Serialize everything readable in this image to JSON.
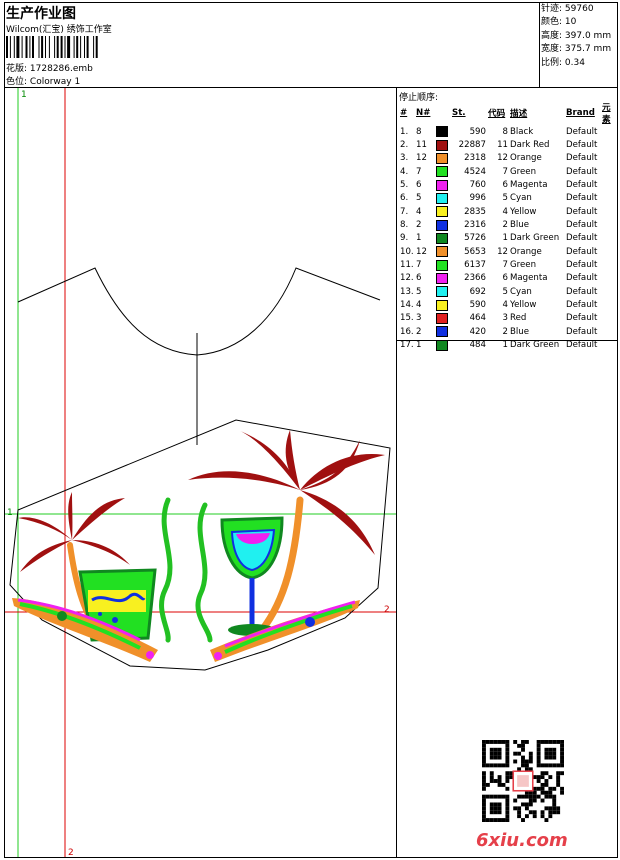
{
  "header": {
    "title": "生产作业图",
    "subtitle": "Wilcom(汇宝) 绣饰工作室",
    "design_label": "花版:",
    "design_value": "1728286.emb",
    "colorway_label": "色位:",
    "colorway_value": "Colorway 1"
  },
  "stats": [
    {
      "label": "针迹:",
      "value": "59760"
    },
    {
      "label": "颜色:",
      "value": "10"
    },
    {
      "label": "高度:",
      "value": "397.0 mm"
    },
    {
      "label": "宽度:",
      "value": "375.7 mm"
    },
    {
      "label": "比例:",
      "value": "0.34"
    }
  ],
  "stop_sequence_label": "停止顺序:",
  "table": {
    "headers": [
      "#",
      "N#",
      "St.",
      "代码",
      "描述",
      "Brand",
      "元素"
    ],
    "rows": [
      {
        "idx": "1.",
        "n": "8",
        "color": "#000000",
        "st": "590",
        "code": "8",
        "desc": "Black",
        "brand": "Default"
      },
      {
        "idx": "2.",
        "n": "11",
        "color": "#a01010",
        "st": "22887",
        "code": "11",
        "desc": "Dark Red",
        "brand": "Default"
      },
      {
        "idx": "3.",
        "n": "12",
        "color": "#f0902a",
        "st": "2318",
        "code": "12",
        "desc": "Orange",
        "brand": "Default"
      },
      {
        "idx": "4.",
        "n": "7",
        "color": "#22e022",
        "st": "4524",
        "code": "7",
        "desc": "Green",
        "brand": "Default"
      },
      {
        "idx": "5.",
        "n": "6",
        "color": "#f020f0",
        "st": "760",
        "code": "6",
        "desc": "Magenta",
        "brand": "Default"
      },
      {
        "idx": "6.",
        "n": "5",
        "color": "#20f0f0",
        "st": "996",
        "code": "5",
        "desc": "Cyan",
        "brand": "Default"
      },
      {
        "idx": "7.",
        "n": "4",
        "color": "#f8f020",
        "st": "2835",
        "code": "4",
        "desc": "Yellow",
        "brand": "Default"
      },
      {
        "idx": "8.",
        "n": "2",
        "color": "#1030e0",
        "st": "2316",
        "code": "2",
        "desc": "Blue",
        "brand": "Default"
      },
      {
        "idx": "9.",
        "n": "1",
        "color": "#108820",
        "st": "5726",
        "code": "1",
        "desc": "Dark Green",
        "brand": "Default"
      },
      {
        "idx": "10.",
        "n": "12",
        "color": "#f0902a",
        "st": "5653",
        "code": "12",
        "desc": "Orange",
        "brand": "Default"
      },
      {
        "idx": "11.",
        "n": "7",
        "color": "#22e022",
        "st": "6137",
        "code": "7",
        "desc": "Green",
        "brand": "Default"
      },
      {
        "idx": "12.",
        "n": "6",
        "color": "#f020f0",
        "st": "2366",
        "code": "6",
        "desc": "Magenta",
        "brand": "Default"
      },
      {
        "idx": "13.",
        "n": "5",
        "color": "#20f0f0",
        "st": "692",
        "code": "5",
        "desc": "Cyan",
        "brand": "Default"
      },
      {
        "idx": "14.",
        "n": "4",
        "color": "#f8f020",
        "st": "590",
        "code": "4",
        "desc": "Yellow",
        "brand": "Default"
      },
      {
        "idx": "15.",
        "n": "3",
        "color": "#e02020",
        "st": "464",
        "code": "3",
        "desc": "Red",
        "brand": "Default"
      },
      {
        "idx": "16.",
        "n": "2",
        "color": "#1030e0",
        "st": "420",
        "code": "2",
        "desc": "Blue",
        "brand": "Default"
      },
      {
        "idx": "17.",
        "n": "1",
        "color": "#108820",
        "st": "484",
        "code": "1",
        "desc": "Dark Green",
        "brand": "Default"
      }
    ]
  },
  "guides": {
    "v1": "1",
    "h1": "1",
    "h2": "2",
    "v2": "2"
  },
  "watermark": "6xiu.com"
}
